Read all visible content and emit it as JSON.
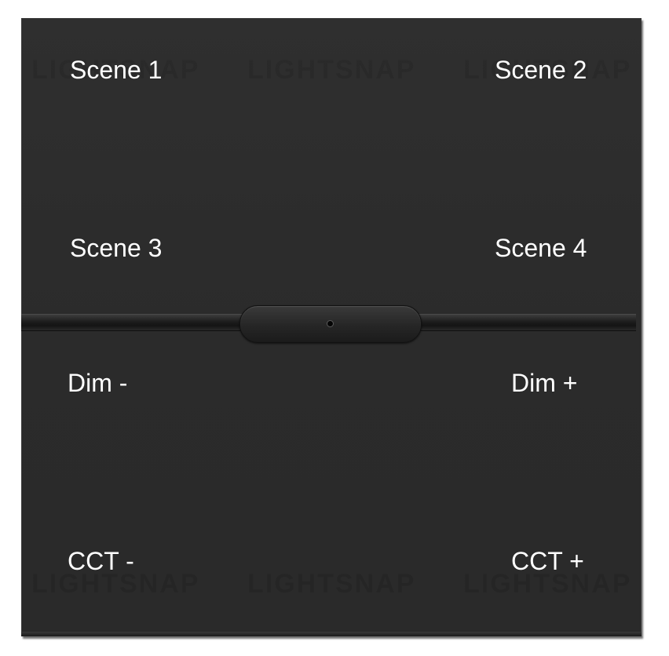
{
  "panel": {
    "buttons": {
      "scene1": "Scene 1",
      "scene2": "Scene 2",
      "scene3": "Scene 3",
      "scene4": "Scene 4",
      "dim_minus": "Dim -",
      "dim_plus": "Dim +",
      "cct_minus": "CCT -",
      "cct_plus": "CCT +"
    },
    "watermark": "LIGHTSNAP",
    "colors": {
      "panel": "#2c2c2c",
      "label": "#ffffff",
      "background": "#ffffff"
    }
  }
}
